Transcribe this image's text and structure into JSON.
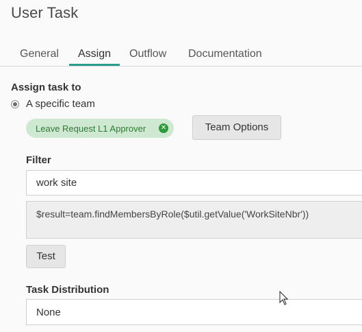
{
  "page": {
    "title": "User Task"
  },
  "tabs": [
    {
      "label": "General",
      "active": false
    },
    {
      "label": "Assign",
      "active": true
    },
    {
      "label": "Outflow",
      "active": false
    },
    {
      "label": "Documentation",
      "active": false
    }
  ],
  "assign": {
    "heading": "Assign task to",
    "radio_label": "A specific team",
    "team_chip": "Leave Request L1 Approver",
    "team_options_button": "Team Options"
  },
  "filter": {
    "label": "Filter",
    "value": "work site",
    "expression": "$result=team.findMembersByRole($util.getValue('WorkSiteNbr'))",
    "test_button": "Test"
  },
  "distribution": {
    "label": "Task Distribution",
    "value": "None"
  },
  "colors": {
    "accent": "#2a9d8f",
    "chip_bg": "#cfe8d2",
    "chip_text": "#2f7a35"
  }
}
